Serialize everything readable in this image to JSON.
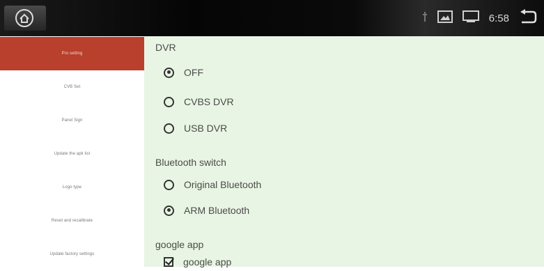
{
  "status": {
    "time": "6:58",
    "icons": [
      "usb-icon",
      "gallery-icon",
      "window-icon",
      "back-icon"
    ]
  },
  "sidebar": {
    "items": [
      {
        "label": "Pro setting",
        "active": true
      },
      {
        "label": "CVB Set",
        "active": false
      },
      {
        "label": "Panel Sign",
        "active": false
      },
      {
        "label": "Update the apk list",
        "active": false
      },
      {
        "label": "Logo type",
        "active": false
      },
      {
        "label": "Reset and recalibrate",
        "active": false
      },
      {
        "label": "Update factory settings",
        "active": false
      }
    ]
  },
  "content": {
    "dvr": {
      "title": "DVR",
      "options": [
        {
          "label": "OFF",
          "selected": true
        },
        {
          "label": "CVBS DVR",
          "selected": false
        },
        {
          "label": "USB DVR",
          "selected": false
        }
      ]
    },
    "bluetooth": {
      "title": "Bluetooth switch",
      "options": [
        {
          "label": "Original Bluetooth",
          "selected": false
        },
        {
          "label": "ARM Bluetooth",
          "selected": true
        }
      ]
    },
    "google": {
      "title": "google app",
      "checkbox_label": "google app",
      "checked": true
    }
  },
  "colors": {
    "sidebar_active": "#b8402c",
    "content_bg": "#e9f5e4",
    "topbar_bg": "#0a0a0a"
  }
}
